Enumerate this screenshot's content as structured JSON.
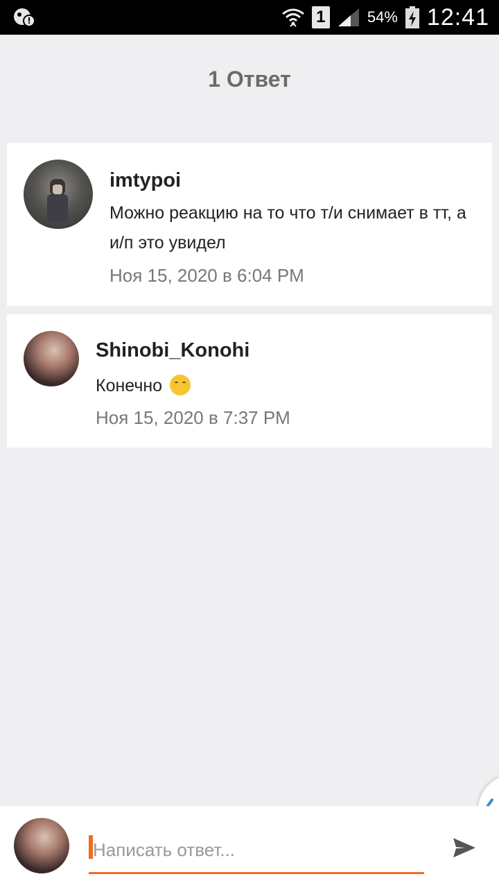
{
  "status_bar": {
    "sim_slot": "1",
    "battery_pct": "54%",
    "time": "12:41"
  },
  "header": {
    "title": "1 Ответ"
  },
  "comments": [
    {
      "username": "imtypoi",
      "message": "Можно реакцию на то что т/и снимает в тт, а и/п это увидел",
      "time": "Ноя 15, 2020 в 6:04 PM"
    },
    {
      "username": "Shinobi_Konohi",
      "message": "Конечно",
      "emoji": "smiling-face-emoji",
      "time": "Ноя 15, 2020 в 7:37 PM"
    }
  ],
  "composer": {
    "placeholder": "Написать ответ..."
  },
  "colors": {
    "accent": "#f26b21",
    "background": "#efeef1",
    "card": "#ffffff",
    "side_arrow": "#3b8fc4"
  }
}
